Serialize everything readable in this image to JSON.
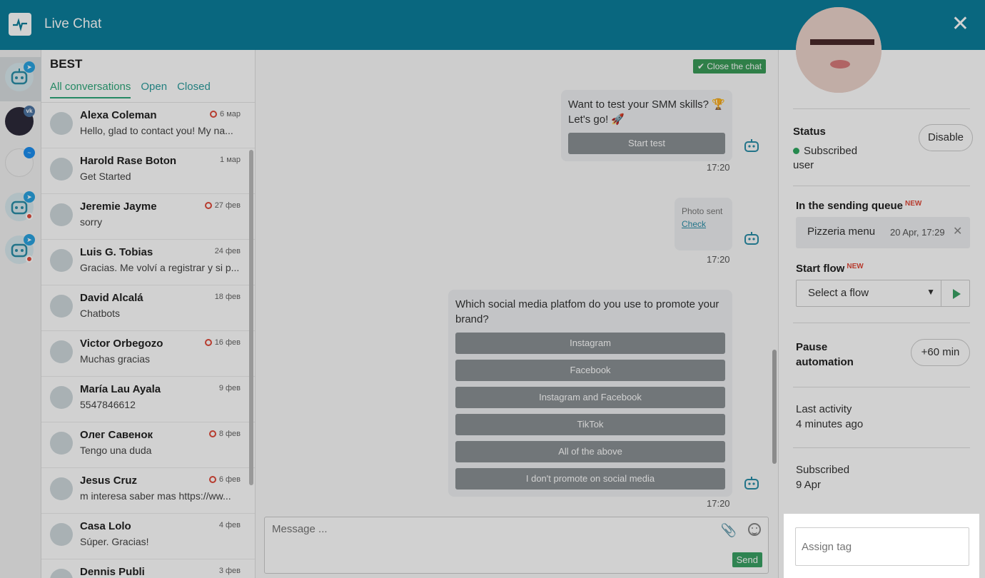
{
  "header": {
    "title": "Live Chat",
    "close": "✕"
  },
  "list": {
    "bot_name": "BEST",
    "tabs": [
      "All conversations",
      "Open",
      "Closed"
    ],
    "conversations": [
      {
        "name": "Alexa Coleman",
        "date": "6 мар",
        "preview": "Hello, glad to contact you! My na...",
        "unread": true
      },
      {
        "name": "Harold Rase Boton",
        "date": "1 мар",
        "preview": "Get Started",
        "unread": false
      },
      {
        "name": "Jeremie Jayme",
        "date": "27 фев",
        "preview": "sorry",
        "unread": true
      },
      {
        "name": "Luis G. Tobias",
        "date": "24 фев",
        "preview": "Gracias. Me volví a registrar y si p...",
        "unread": false
      },
      {
        "name": "David Alcalá",
        "date": "18 фев",
        "preview": "Chatbots",
        "unread": false
      },
      {
        "name": "Victor Orbegozo",
        "date": "16 фев",
        "preview": "Muchas gracias",
        "unread": true
      },
      {
        "name": "María Lau Ayala",
        "date": "9 фев",
        "preview": "5547846612",
        "unread": false
      },
      {
        "name": "Олег Савенок",
        "date": "8 фев",
        "preview": "Tengo una duda",
        "unread": true
      },
      {
        "name": "Jesus Cruz",
        "date": "6 фев",
        "preview": "m interesa saber mas https://ww...",
        "unread": true
      },
      {
        "name": "Casa Lolo",
        "date": "4 фев",
        "preview": "Súper. Gracias!",
        "unread": false
      },
      {
        "name": "Dennis Publi",
        "date": "3 фев",
        "preview": "",
        "unread": false
      }
    ]
  },
  "chat": {
    "close_chat": "Close the chat",
    "msg1": {
      "text": "Want to test your SMM skills? 🏆 Let's go! 🚀",
      "button": "Start test",
      "time": "17:20"
    },
    "msg2": {
      "text": "Photo sent",
      "link": "Check",
      "time": "17:20"
    },
    "msg3": {
      "text": "Which social media platfom do you use to promote your brand?",
      "buttons": [
        "Instagram",
        "Facebook",
        "Instagram and Facebook",
        "TikTok",
        "All of the above",
        "I don't promote on social media"
      ],
      "time": "17:20"
    },
    "composer": {
      "placeholder": "Message ...",
      "send": "Send"
    }
  },
  "panel": {
    "status_label": "Status",
    "status_value": "Subscribed user",
    "disable": "Disable",
    "queue_label": "In the sending queue",
    "new_badge": "NEW",
    "queue_item": "Pizzeria menu",
    "queue_time": "20 Apr, 17:29",
    "flow_label": "Start flow",
    "flow_select": "Select a flow",
    "pause_label": "Pause automation",
    "pause_btn": "+60 min",
    "last_activity_label": "Last activity",
    "last_activity_value": "4 minutes ago",
    "subscribed_label": "Subscribed",
    "subscribed_value": "9 Apr",
    "tag_placeholder": "Assign tag"
  },
  "colors": {
    "header": "#0b7e9b",
    "accent_green": "#2ea87a",
    "send_green": "#3aa264"
  }
}
